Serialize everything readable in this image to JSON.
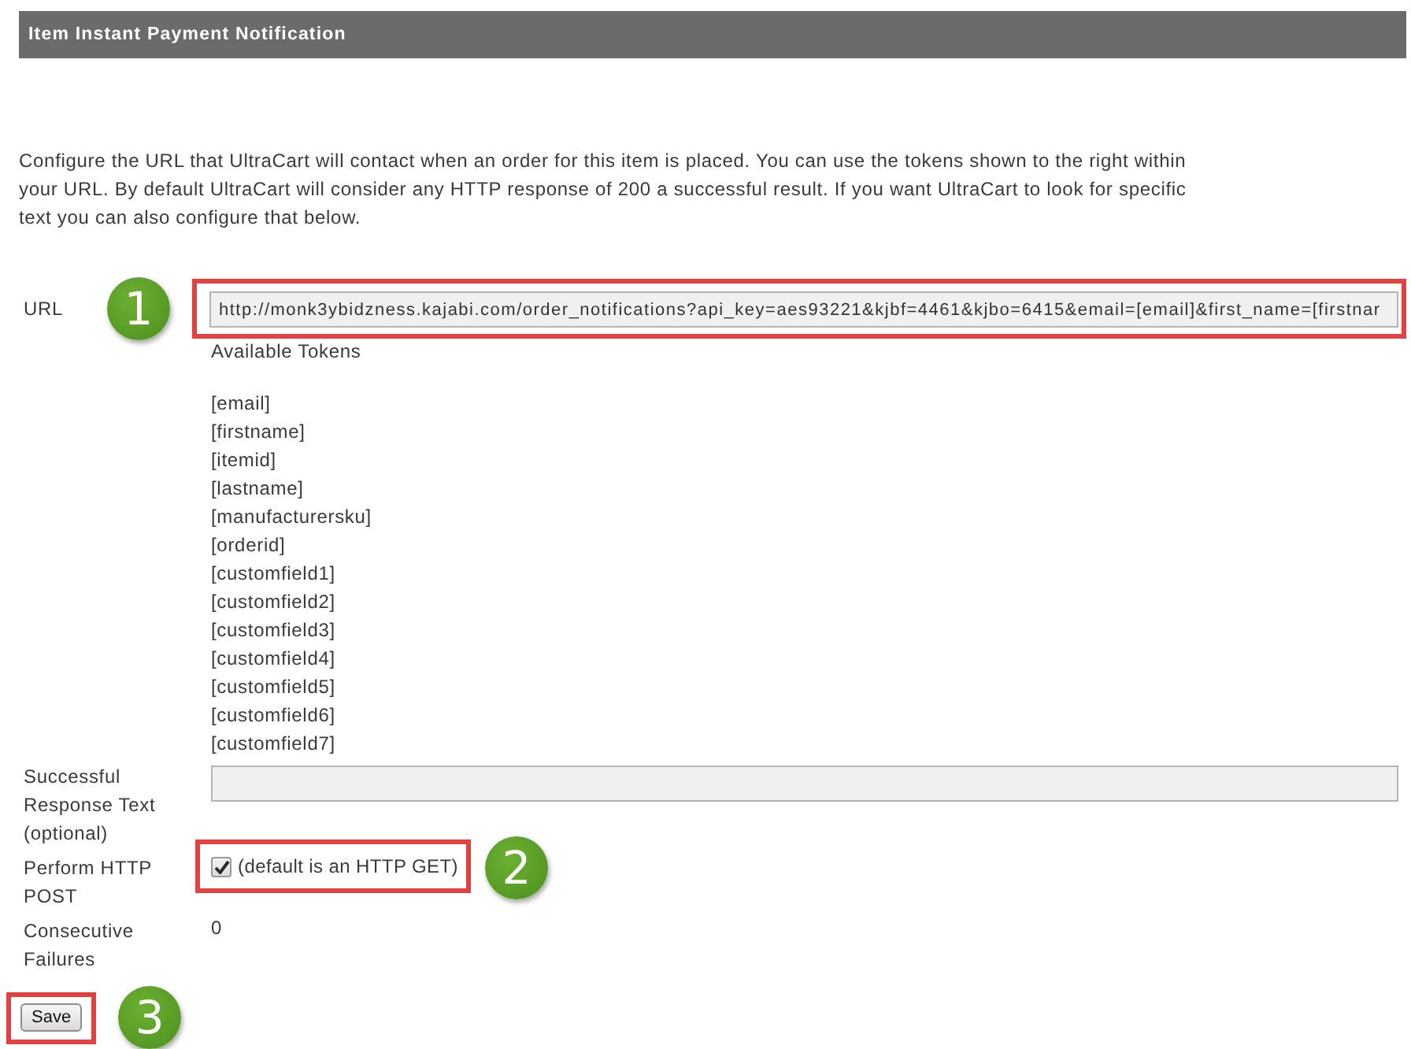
{
  "header": {
    "title": "Item Instant Payment Notification"
  },
  "intro": "Configure the URL that UltraCart will contact when an order for this item is placed. You can use the tokens shown to the right within your URL. By default UltraCart will consider any HTTP response of 200 a successful result. If you want UltraCart to look for specific text you can also configure that below.",
  "form": {
    "url": {
      "label": "URL",
      "value": "http://monk3ybidzness.kajabi.com/order_notifications?api_key=aes93221&kjbf=4461&kjbo=6415&email=[email]&first_name=[firstnar",
      "callout": "1"
    },
    "tokens": {
      "heading": "Available Tokens",
      "items": [
        "[email]",
        "[firstname]",
        "[itemid]",
        "[lastname]",
        "[manufacturersku]",
        "[orderid]",
        "[customfield1]",
        "[customfield2]",
        "[customfield3]",
        "[customfield4]",
        "[customfield5]",
        "[customfield6]",
        "[customfield7]"
      ]
    },
    "response_text": {
      "label": "Successful Response Text (optional)"
    },
    "http_post": {
      "label": "Perform HTTP POST",
      "checked": true,
      "note": "(default is an HTTP GET)",
      "callout": "2"
    },
    "failures": {
      "label": "Consecutive Failures",
      "value": "0"
    }
  },
  "save": {
    "label": "Save",
    "callout": "3"
  }
}
